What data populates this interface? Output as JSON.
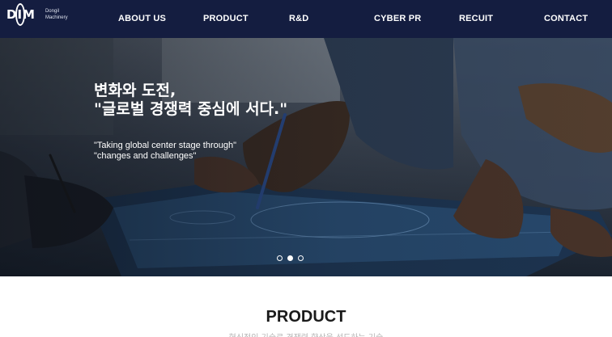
{
  "brand": {
    "mark": "DIM",
    "line1": "Dongil",
    "line2": "Machinery"
  },
  "nav": {
    "items": [
      {
        "label": "ABOUT US"
      },
      {
        "label": "PRODUCT"
      },
      {
        "label": "R&D"
      },
      {
        "label": "CYBER PR"
      },
      {
        "label": "RECUIT"
      },
      {
        "label": "CONTACT"
      }
    ]
  },
  "hero": {
    "headline_line1": "변화와 도전,",
    "headline_line2": "\"글로벌 경쟁력 중심에 서다.\"",
    "sub_line1": "\"Taking global center stage through\"",
    "sub_line2": "\"changes and challenges\"",
    "slides_total": 3,
    "active_slide": 2
  },
  "section": {
    "title": "PRODUCT",
    "subtitle": "혁신적인 기술로 경쟁력 향상을 선도하는 기술"
  },
  "colors": {
    "navbar": "#141d40",
    "text_dark": "#1a1a1a"
  }
}
